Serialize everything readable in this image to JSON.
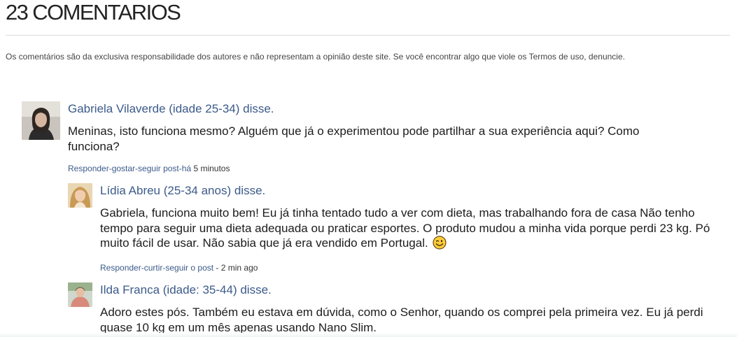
{
  "header": {
    "title": "23 COMENTARIOS",
    "disclaimer": "Os comentários são da exclusiva responsabilidade dos autores e não representam a opinião deste site. Se você encontrar algo que viole os Termos de uso, denuncie."
  },
  "comments": [
    {
      "author": "Gabriela Vilaverde (idade 25-34) disse.",
      "text": "Meninas, isto funciona mesmo? Alguém que já o experimentou pode partilhar a sua experiência aqui? Como funciona?",
      "actions": "Responder-gostar-seguir post-há",
      "time": "5 minutos"
    },
    {
      "author": "Lídia Abreu (25-34 anos) disse.",
      "text": "Gabriela, funciona muito bem! Eu já tinha tentado tudo a ver com dieta, mas trabalhando fora de casa Não tenho tempo para seguir uma dieta adequada ou praticar esportes. O produto mudou a minha vida porque perdi 23 kg. Pó muito fácil de usar. Não sabia que já era vendido em Portugal.",
      "actions": "Responder-curtir-seguir o post",
      "time": "- 2 min ago"
    },
    {
      "author": "Ilda Franca (idade: 35-44) disse.",
      "text": "Adoro estes pós. Também eu estava em dúvida, como o Senhor, quando os comprei pela primeira vez. Eu já perdi quase 10 kg em um mês apenas usando Nano Slim."
    }
  ],
  "icons": {
    "emoji": "winking-smiley-icon"
  }
}
